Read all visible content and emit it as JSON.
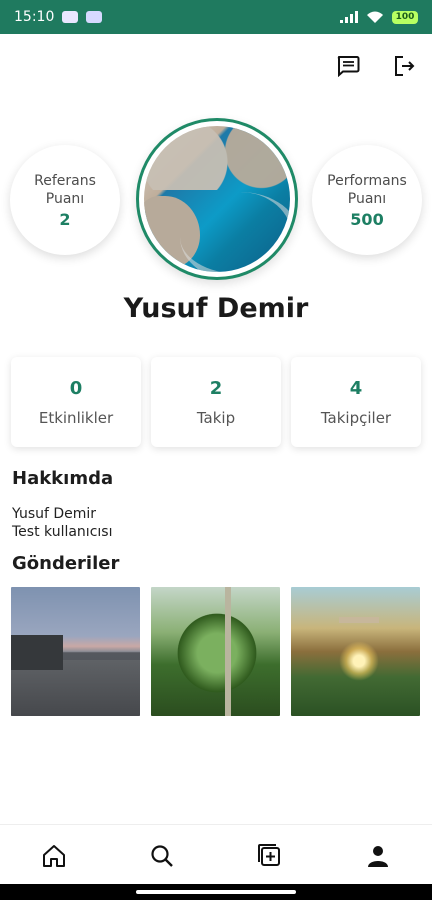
{
  "status_bar": {
    "time": "15:10",
    "battery": "100"
  },
  "profile": {
    "name": "Yusuf Demir",
    "referans": {
      "label": "Referans\nPuanı",
      "value": "2"
    },
    "performans": {
      "label": "Performans\nPuanı",
      "value": "500"
    }
  },
  "stats": [
    {
      "num": "0",
      "label": "Etkinlikler"
    },
    {
      "num": "2",
      "label": "Takip"
    },
    {
      "num": "4",
      "label": "Takipçiler"
    }
  ],
  "about": {
    "title": "Hakkımda",
    "line1": "Yusuf Demir",
    "line2": "Test kullanıcısı"
  },
  "posts": {
    "title": "Gönderiler"
  },
  "colors": {
    "accent": "#1d7f63",
    "status_bar": "#1f7a5f"
  },
  "icons": {
    "top_actions": [
      "chat-icon",
      "logout-icon"
    ],
    "bottom_nav": [
      "home-icon",
      "search-icon",
      "add-post-icon",
      "profile-icon"
    ]
  }
}
